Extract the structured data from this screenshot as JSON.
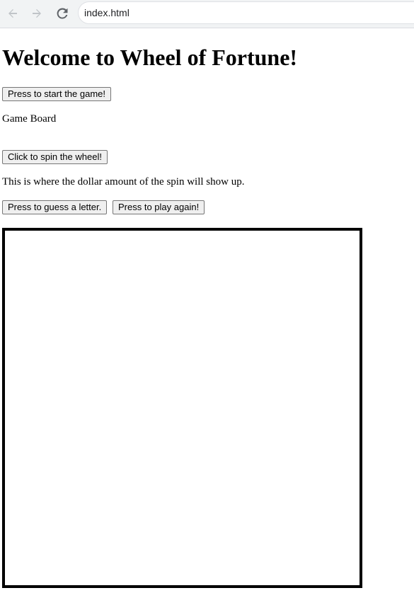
{
  "browser": {
    "address": "index.html",
    "icons": [
      "back-arrow-icon",
      "forward-arrow-icon",
      "reload-icon"
    ]
  },
  "page": {
    "heading": "Welcome to Wheel of Fortune!",
    "start_button": "Press to start the game!",
    "game_board_label": "Game Board",
    "spin_button": "Click to spin the wheel!",
    "spin_result_text": "This is where the dollar amount of the spin will show up.",
    "guess_button": "Press to guess a letter.",
    "play_again_button": "Press to play again!"
  }
}
